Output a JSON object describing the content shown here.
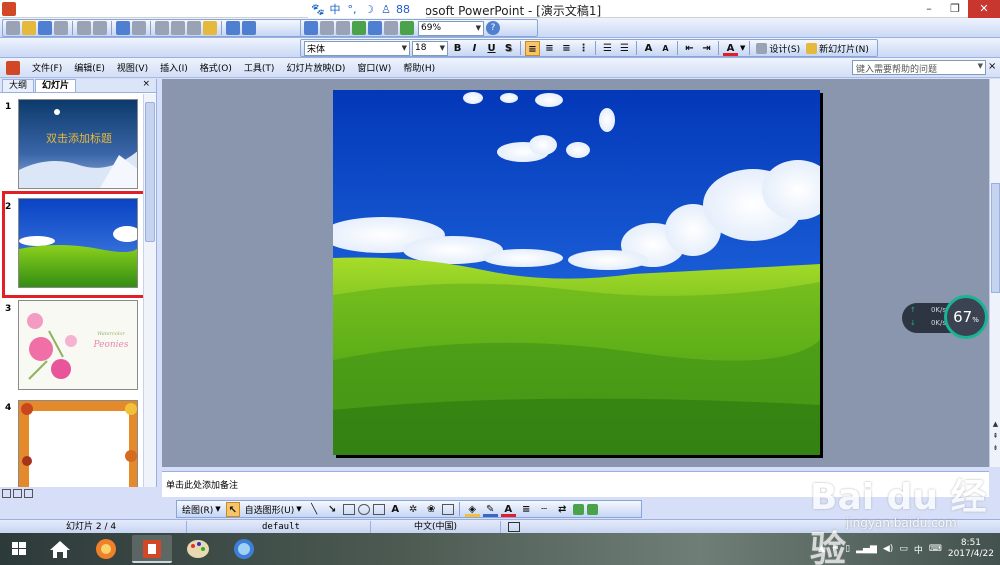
{
  "window": {
    "title": "rosoft PowerPoint - [演示文稿1]",
    "controls": {
      "minimize": "–",
      "restore": "❐",
      "close": "✕"
    }
  },
  "ime_bar": [
    "🐾",
    "中",
    "°,",
    "☽",
    "♙",
    "88"
  ],
  "standard_toolbar": {
    "zoom_value": "69%",
    "help_icon": "?"
  },
  "formatting_toolbar": {
    "font_name": "宋体",
    "font_size": "18",
    "bold": "B",
    "italic": "I",
    "underline": "U",
    "shadow": "S",
    "font_color_label": "A",
    "design_label": "设计(S)",
    "new_slide_label": "新幻灯片(N)"
  },
  "menu": {
    "items": [
      "文件(F)",
      "编辑(E)",
      "视图(V)",
      "插入(I)",
      "格式(O)",
      "工具(T)",
      "幻灯片放映(D)",
      "窗口(W)",
      "帮助(H)"
    ],
    "help_placeholder": "键入需要帮助的问题",
    "close": "×"
  },
  "left_pane": {
    "tabs": [
      "大纲",
      "幻灯片"
    ],
    "close": "×",
    "slides": [
      {
        "number": "1",
        "title_text": "双击添加标题"
      },
      {
        "number": "2"
      },
      {
        "number": "3",
        "caption_line1": "Watercolor",
        "caption_line2": "Peonies"
      },
      {
        "number": "4"
      }
    ],
    "selected_index": 2
  },
  "notes_placeholder": "单击此处添加备注",
  "net_widget": {
    "up_speed": "0K/s",
    "down_speed": "0K/s",
    "percent": "67",
    "percent_unit": "%"
  },
  "draw_toolbar": {
    "draw_label": "绘图(R)",
    "autoshape_label": "自选图形(U)"
  },
  "status_bar": {
    "slide_info": "幻灯片 2 / 4",
    "template": "default",
    "language": "中文(中国)"
  },
  "taskbar": {
    "time": "8:51",
    "date": "2017/4/22",
    "ime": "中"
  },
  "watermark": {
    "main": "Bai du 经验",
    "sub": "jingyan.baidu.com"
  },
  "colors": {
    "selection_border": "#e21e26",
    "office_blue": "#c6d6f4",
    "edit_background": "#8996ad"
  }
}
